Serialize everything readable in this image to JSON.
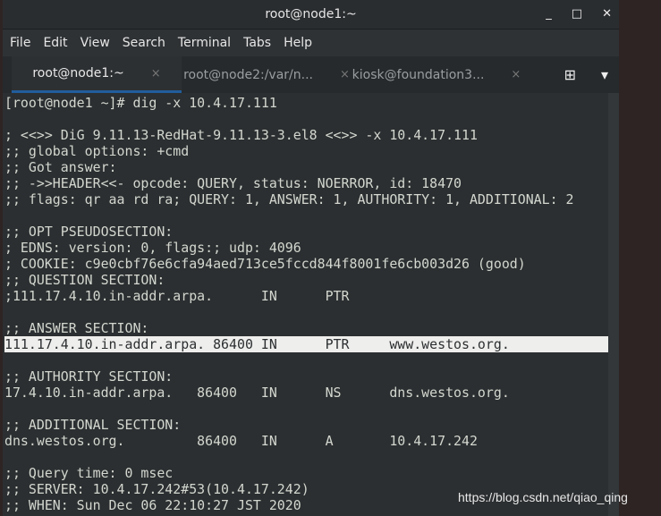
{
  "window": {
    "title": "root@node1:~",
    "minimize": "_",
    "maximize": "□",
    "close": "✕"
  },
  "menu": [
    "File",
    "Edit",
    "View",
    "Search",
    "Terminal",
    "Tabs",
    "Help"
  ],
  "tabs": [
    {
      "label": "root@node1:~",
      "active": true
    },
    {
      "label": "root@node2:/var/n...",
      "active": false
    },
    {
      "label": "kiosk@foundation3...",
      "active": false
    }
  ],
  "tab_close": "×",
  "tab_tools": {
    "new_tab_icon": "⊞",
    "menu_icon": "▾"
  },
  "terminal": {
    "lines": [
      "[root@node1 ~]# dig -x 10.4.17.111",
      "",
      "; <<>> DiG 9.11.13-RedHat-9.11.13-3.el8 <<>> -x 10.4.17.111",
      ";; global options: +cmd",
      ";; Got answer:",
      ";; ->>HEADER<<- opcode: QUERY, status: NOERROR, id: 18470",
      ";; flags: qr aa rd ra; QUERY: 1, ANSWER: 1, AUTHORITY: 1, ADDITIONAL: 2",
      "",
      ";; OPT PSEUDOSECTION:",
      "; EDNS: version: 0, flags:; udp: 4096",
      "; COOKIE: c9e0cbf76e6cfa94aed713ce5fccd844f8001fe6cb003d26 (good)",
      ";; QUESTION SECTION:",
      ";111.17.4.10.in-addr.arpa.      IN      PTR",
      "",
      ";; ANSWER SECTION:",
      "111.17.4.10.in-addr.arpa. 86400 IN      PTR     www.westos.org.",
      "",
      ";; AUTHORITY SECTION:",
      "17.4.10.in-addr.arpa.   86400   IN      NS      dns.westos.org.",
      "",
      ";; ADDITIONAL SECTION:",
      "dns.westos.org.         86400   IN      A       10.4.17.242",
      "",
      ";; Query time: 0 msec",
      ";; SERVER: 10.4.17.242#53(10.4.17.242)",
      ";; WHEN: Sun Dec 06 22:10:27 JST 2020"
    ],
    "highlighted_line": 15
  },
  "watermark": "https://blog.csdn.net/qiao_qing"
}
